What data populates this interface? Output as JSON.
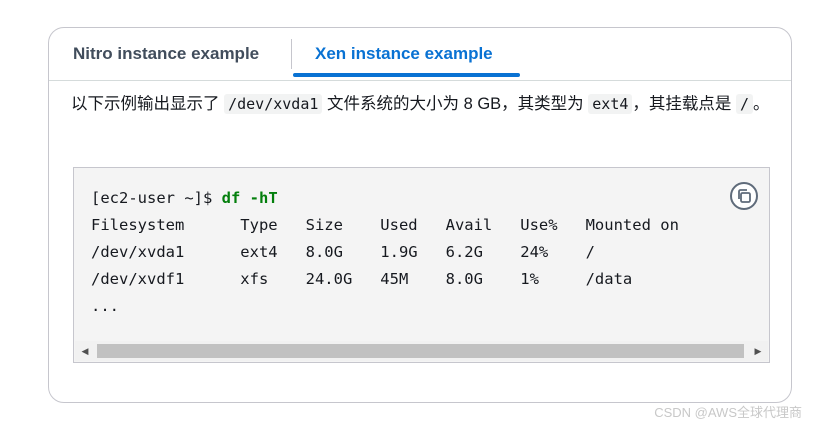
{
  "tabs": [
    {
      "label": "Nitro instance example",
      "selected": false
    },
    {
      "label": "Xen instance example",
      "selected": true
    }
  ],
  "description": {
    "part1": "以下示例输出显示了",
    "device_code": "/dev/xvda1",
    "part2": "文件系统的大小为 8 GB，其类型为",
    "type_code": "ext4",
    "part3": "，其挂载点是",
    "mount_code": "/",
    "part4": "。"
  },
  "code": {
    "prompt": "[ec2-user ~]$ ",
    "command": "df -hT",
    "header": "Filesystem      Type   Size    Used   Avail   Use%   Mounted on",
    "rows": [
      "/dev/xvda1      ext4   8.0G    1.9G   6.2G    24%    /",
      "/dev/xvdf1      xfs    24.0G   45M    8.0G    1%     /data"
    ],
    "ellipsis": "..."
  },
  "icons": {
    "copy": "copy-icon",
    "scroll_left": "scroll-left-icon",
    "scroll_right": "scroll-right-icon"
  },
  "watermark": "CSDN @AWS全球代理商",
  "colors": {
    "accent": "#0972d3",
    "command": "#037f0c"
  }
}
